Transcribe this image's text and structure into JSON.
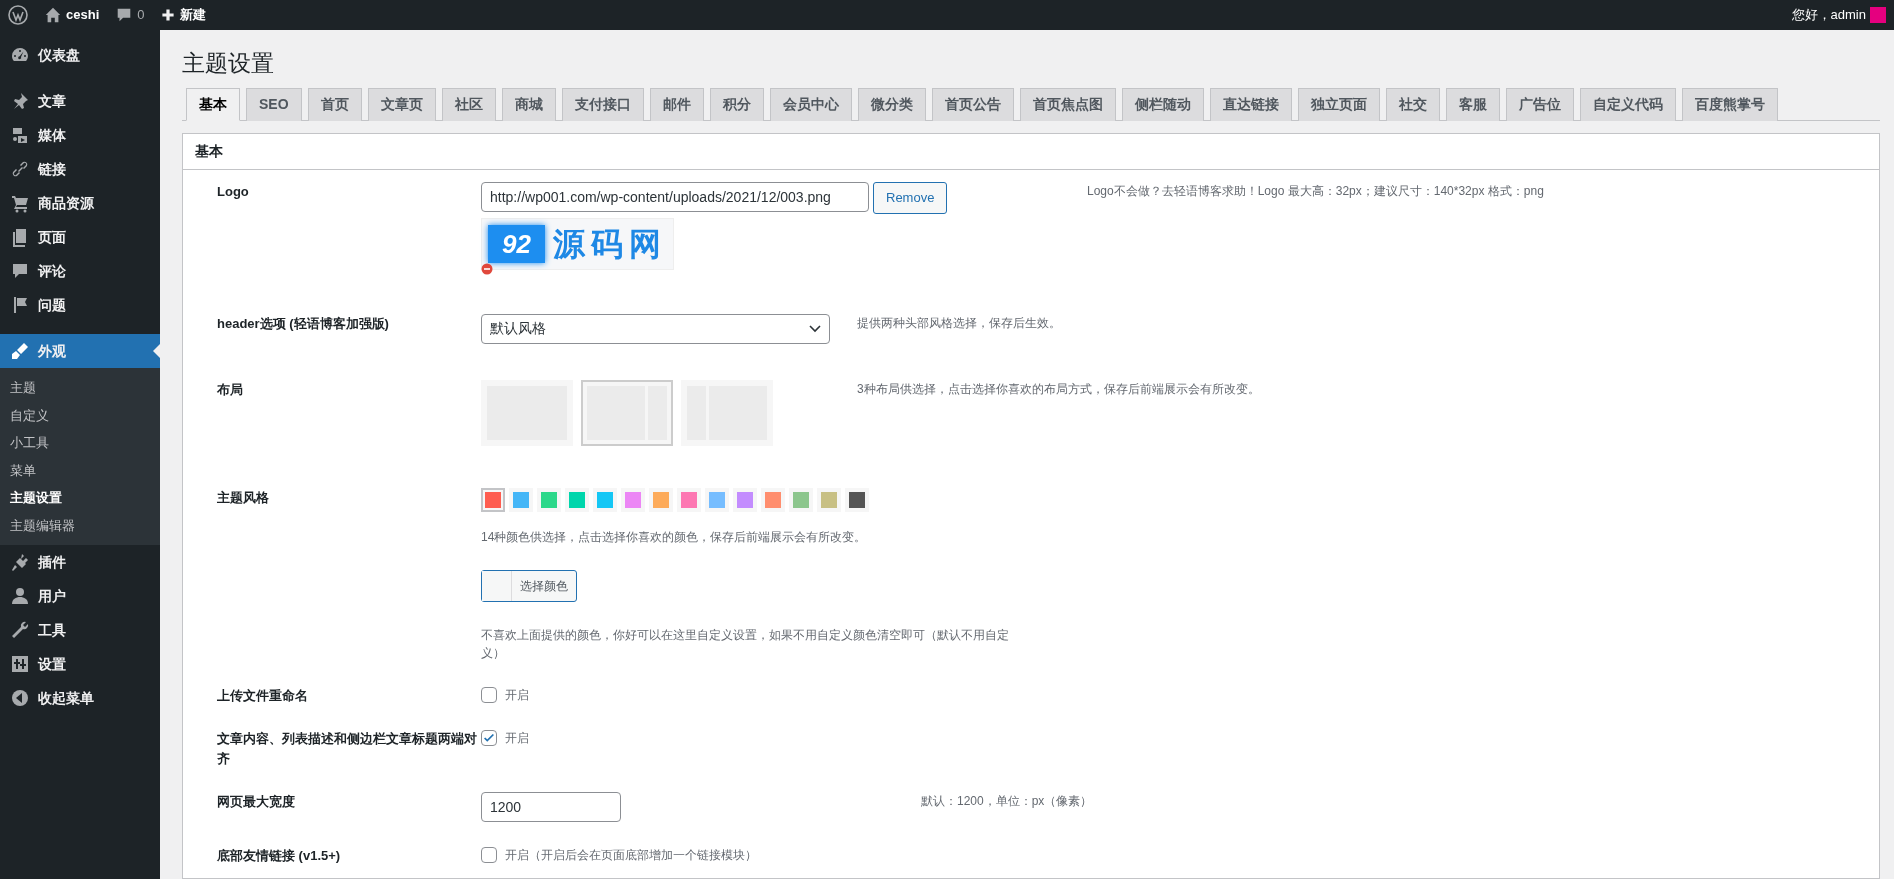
{
  "admin_bar": {
    "site": "ceshi",
    "comments": "0",
    "new": "新建",
    "greeting": "您好，admin"
  },
  "sidebar": {
    "items": [
      {
        "label": "仪表盘",
        "current": false
      },
      {
        "label": "文章",
        "current": false
      },
      {
        "label": "媒体",
        "current": false
      },
      {
        "label": "链接",
        "current": false
      },
      {
        "label": "商品资源",
        "current": false
      },
      {
        "label": "页面",
        "current": false
      },
      {
        "label": "评论",
        "current": false
      },
      {
        "label": "问题",
        "current": false
      },
      {
        "label": "外观",
        "current": true,
        "children": [
          {
            "label": "主题",
            "selected": false
          },
          {
            "label": "自定义",
            "selected": false
          },
          {
            "label": "小工具",
            "selected": false
          },
          {
            "label": "菜单",
            "selected": false
          },
          {
            "label": "主题设置",
            "selected": true
          },
          {
            "label": "主题编辑器",
            "selected": false
          }
        ]
      },
      {
        "label": "插件",
        "current": false
      },
      {
        "label": "用户",
        "current": false
      },
      {
        "label": "工具",
        "current": false
      },
      {
        "label": "设置",
        "current": false
      },
      {
        "label": "收起菜单",
        "current": false
      }
    ]
  },
  "page_title": "主题设置",
  "tabs": [
    {
      "label": "基本",
      "selected": true
    },
    {
      "label": "SEO",
      "selected": false
    },
    {
      "label": "首页",
      "selected": false
    },
    {
      "label": "文章页",
      "selected": false
    },
    {
      "label": "社区",
      "selected": false
    },
    {
      "label": "商城",
      "selected": false
    },
    {
      "label": "支付接口",
      "selected": false
    },
    {
      "label": "邮件",
      "selected": false
    },
    {
      "label": "积分",
      "selected": false
    },
    {
      "label": "会员中心",
      "selected": false
    },
    {
      "label": "微分类",
      "selected": false
    },
    {
      "label": "首页公告",
      "selected": false
    },
    {
      "label": "首页焦点图",
      "selected": false
    },
    {
      "label": "侧栏随动",
      "selected": false
    },
    {
      "label": "直达链接",
      "selected": false
    },
    {
      "label": "独立页面",
      "selected": false
    },
    {
      "label": "社交",
      "selected": false
    },
    {
      "label": "客服",
      "selected": false
    },
    {
      "label": "广告位",
      "selected": false
    },
    {
      "label": "自定义代码",
      "selected": false
    },
    {
      "label": "百度熊掌号",
      "selected": false
    }
  ],
  "panel": {
    "title": "基本",
    "rows": [
      {
        "kind": "media",
        "label": "Logo",
        "value": "http://wp001.com/wp-content/uploads/2021/12/003.png",
        "button": "Remove",
        "preview": {
          "badge": "92",
          "text": "源码网"
        },
        "description": "Logo不会做？去轻语博客求助！Logo 最大高：32px；建议尺寸：140*32px 格式：png"
      },
      {
        "kind": "select",
        "label": "header选项 (轻语博客加强版)",
        "value": "默认风格",
        "description": "提供两种头部风格选择，保存后生效。"
      },
      {
        "kind": "layout",
        "label": "布局",
        "options": [
          {
            "kind": "full",
            "selected": false
          },
          {
            "kind": "right",
            "selected": true
          },
          {
            "kind": "left",
            "selected": false
          }
        ],
        "description": "3种布局供选择，点击选择你喜欢的布局方式，保存后前端展示会有所改变。"
      },
      {
        "kind": "swatches",
        "label": "主题风格",
        "swatches": [
          {
            "color": "#fe5d50",
            "selected": true
          },
          {
            "color": "#45b6f7",
            "selected": false
          },
          {
            "color": "#2cd88a",
            "selected": false
          },
          {
            "color": "#00d6ac",
            "selected": false
          },
          {
            "color": "#15c7f5",
            "selected": false
          },
          {
            "color": "#ec86f5",
            "selected": false
          },
          {
            "color": "#fdab5a",
            "selected": false
          },
          {
            "color": "#fd77b2",
            "selected": false
          },
          {
            "color": "#76bdff",
            "selected": false
          },
          {
            "color": "#c38cfe",
            "selected": false
          },
          {
            "color": "#ff8e6e",
            "selected": false
          },
          {
            "color": "#8cc68d",
            "selected": false
          },
          {
            "color": "#c8c084",
            "selected": false
          },
          {
            "color": "#555555",
            "selected": false
          }
        ],
        "description": "14种颜色供选择，点击选择你喜欢的颜色，保存后前端展示会有所改变。",
        "picker": "选择颜色",
        "picker_description": "不喜欢上面提供的颜色，你好可以在这里自定义设置，如果不用自定义颜色清空即可（默认不用自定义）"
      },
      {
        "kind": "checkbox",
        "label": "上传文件重命名",
        "checked": false,
        "option": "开启"
      },
      {
        "kind": "checkbox",
        "label": "文章内容、列表描述和侧边栏文章标题两端对齐",
        "checked": true,
        "option": "开启"
      },
      {
        "kind": "number",
        "label": "网页最大宽度",
        "value": "1200",
        "description": "默认：1200，单位：px（像素）"
      },
      {
        "kind": "checkbox",
        "label": "底部友情链接 (v1.5+)",
        "checked": false,
        "option": "开启（开启后会在页面底部增加一个链接模块）"
      }
    ]
  }
}
